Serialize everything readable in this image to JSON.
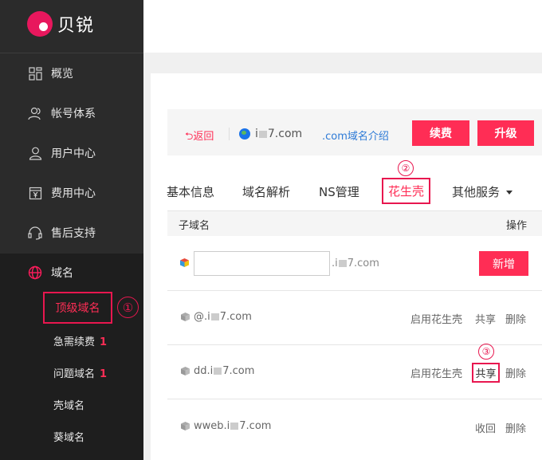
{
  "brand": {
    "name": "贝锐"
  },
  "sidebar": {
    "items": [
      {
        "label": "概览",
        "icon": "dashboard-icon"
      },
      {
        "label": "帐号体系",
        "icon": "users-icon"
      },
      {
        "label": "用户中心",
        "icon": "user-icon"
      },
      {
        "label": "费用中心",
        "icon": "billing-icon"
      },
      {
        "label": "售后支持",
        "icon": "headset-icon"
      },
      {
        "label": "域名",
        "icon": "globe-icon"
      }
    ],
    "submenu": [
      {
        "label": "顶级域名",
        "badge": ""
      },
      {
        "label": "急需续费",
        "badge": "1"
      },
      {
        "label": "问题域名",
        "badge": "1"
      },
      {
        "label": "壳域名",
        "badge": ""
      },
      {
        "label": "葵域名",
        "badge": ""
      }
    ]
  },
  "header": {
    "back_label": "返回",
    "domain_prefix": "i",
    "domain_suffix": "7.com",
    "intro_link": ".com域名介绍",
    "renew_button": "续费",
    "upgrade_button": "升级"
  },
  "tabs": [
    {
      "label": "基本信息"
    },
    {
      "label": "域名解析"
    },
    {
      "label": "NS管理"
    },
    {
      "label": "花生壳"
    },
    {
      "label": "其他服务"
    }
  ],
  "table": {
    "col_subdomain": "子域名",
    "col_action": "操作",
    "input_suffix_prefix": ".i",
    "input_suffix_suffix": "7.com",
    "add_button": "新增",
    "rows": [
      {
        "prefix": "@.i",
        "suffix": "7.com",
        "actions": [
          "启用花生壳",
          "共享",
          "删除"
        ]
      },
      {
        "prefix": "dd.i",
        "suffix": "7.com",
        "actions": [
          "启用花生壳",
          "共享",
          "删除"
        ]
      },
      {
        "prefix": "wweb.i",
        "suffix": "7.com",
        "actions": [
          "收回",
          "删除"
        ]
      }
    ]
  },
  "callouts": [
    "①",
    "②",
    "③"
  ],
  "colors": {
    "accent": "#ff2d55",
    "sidebar_bg": "#2b2b2b",
    "submenu_bg": "#1e1e1e",
    "link": "#2d7ad6"
  }
}
